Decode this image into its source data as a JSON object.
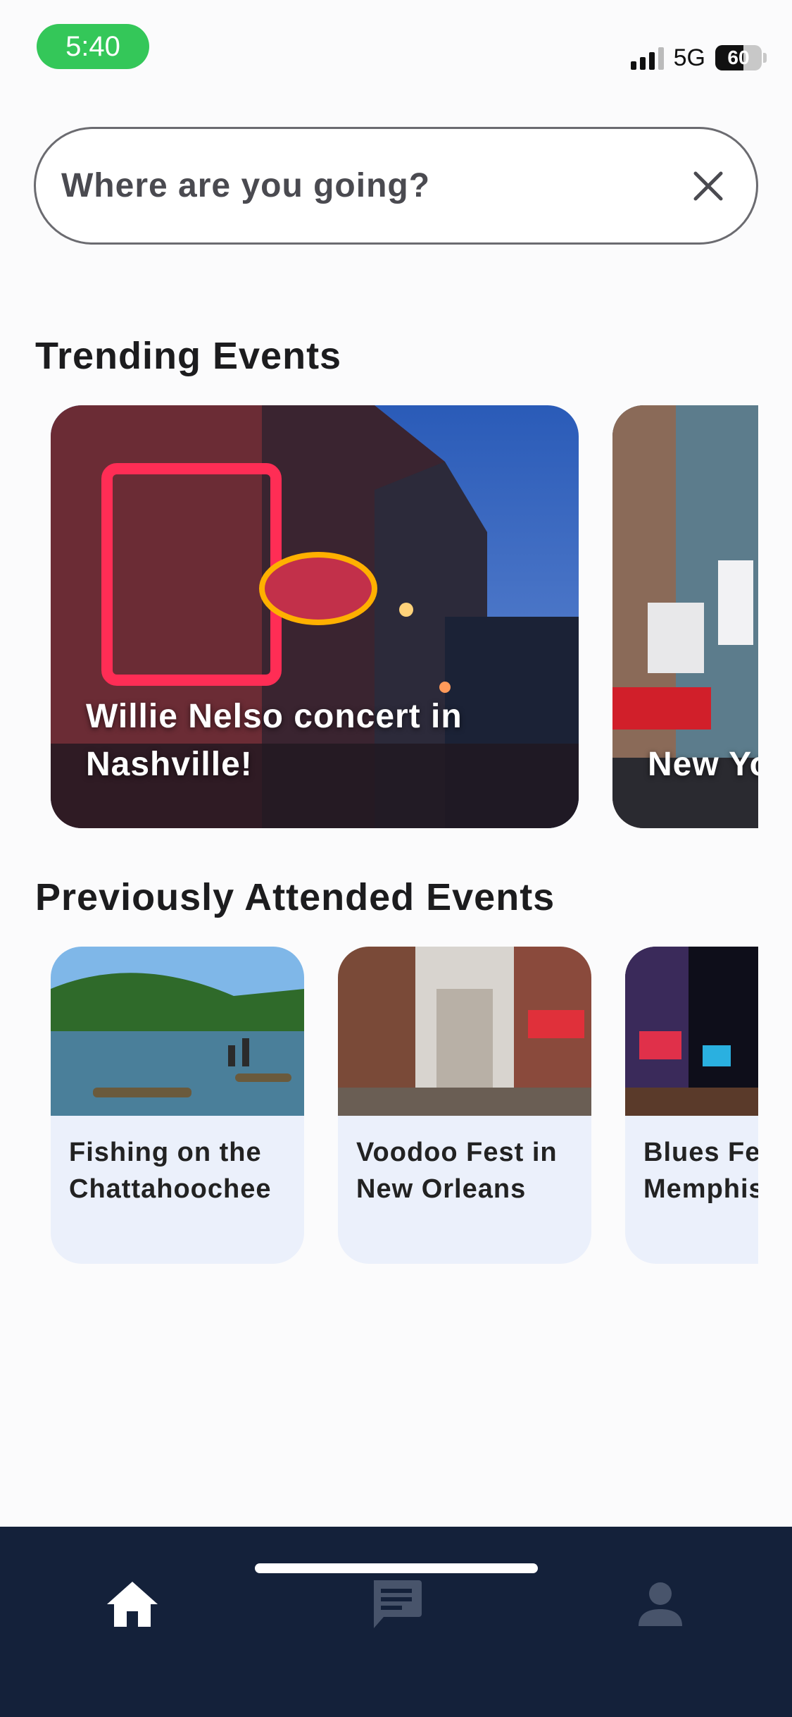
{
  "status_bar": {
    "time": "5:40",
    "network": "5G",
    "battery": "60"
  },
  "search": {
    "placeholder": "Where are you going?"
  },
  "sections": {
    "trending_title": "Trending Events",
    "previous_title": "Previously Attended Events"
  },
  "trending": [
    {
      "title": "Willie Nelso concert in Nashville!"
    },
    {
      "title": "New York New York"
    }
  ],
  "previous": [
    {
      "title": "Fishing on the Chattahoochee"
    },
    {
      "title": "Voodoo Fest in New Orleans"
    },
    {
      "title": "Blues Fest in Memphis"
    }
  ],
  "nav": [
    {
      "name": "home",
      "icon": "home-icon",
      "active": true
    },
    {
      "name": "messages",
      "icon": "chat-icon",
      "active": false
    },
    {
      "name": "profile",
      "icon": "person-icon",
      "active": false
    }
  ],
  "colors": {
    "nav_bg": "#14213a",
    "card_bg": "#ebf0fb",
    "time_pill": "#34c759",
    "nav_inactive": "#48546b"
  }
}
